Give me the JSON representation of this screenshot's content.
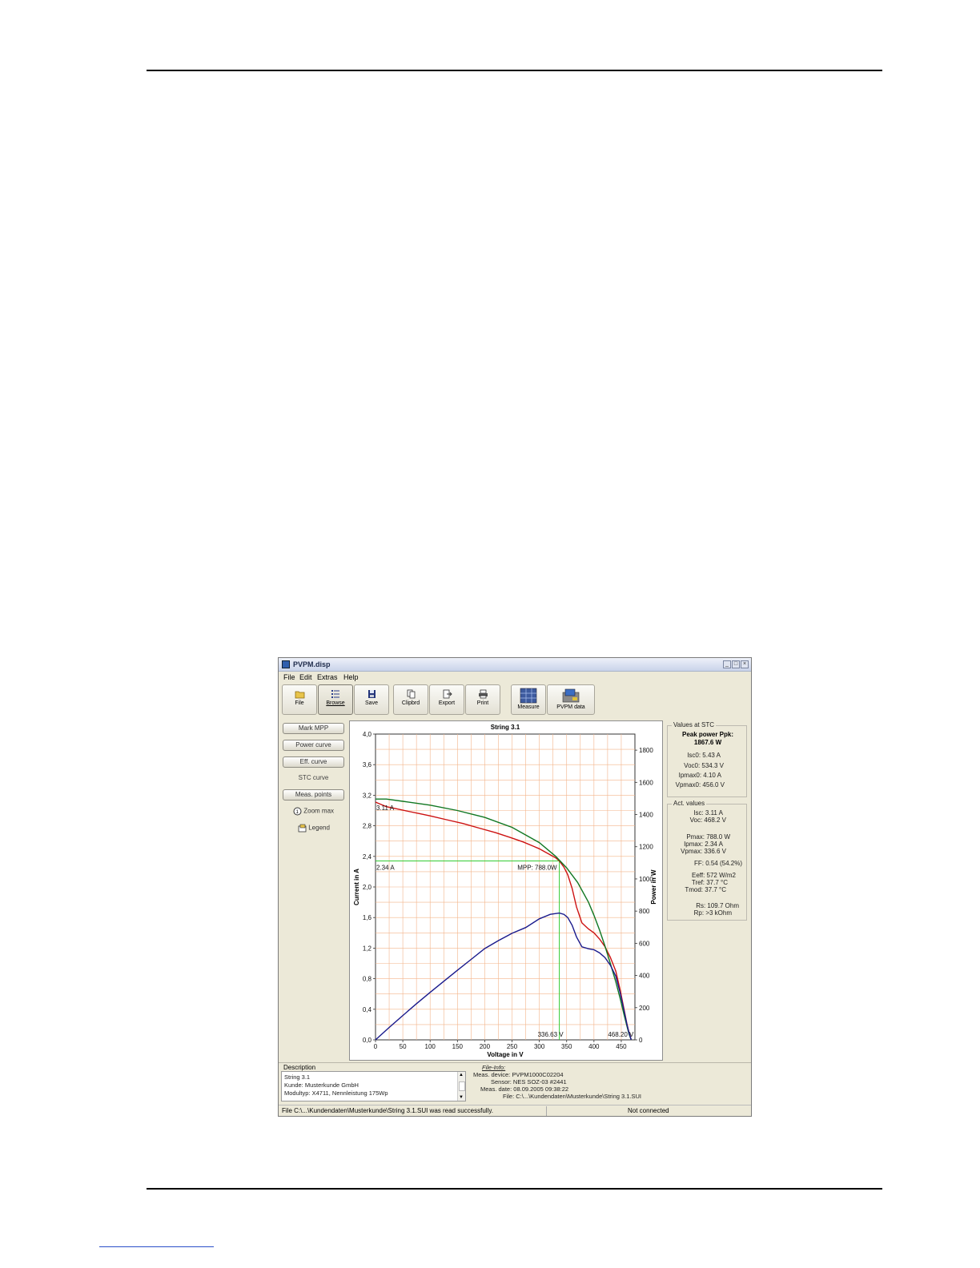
{
  "window": {
    "title": "PVPM.disp",
    "controls": [
      "_",
      "□",
      "×"
    ]
  },
  "menu": [
    "File",
    "Edit",
    "Extras",
    "Help"
  ],
  "toolbar": [
    {
      "label": "File",
      "icon": "folder-icon"
    },
    {
      "label": "Browse",
      "icon": "browse-icon",
      "active": true
    },
    {
      "label": "Save",
      "icon": "floppy-icon"
    },
    {
      "label": "Clipbrd",
      "icon": "clipboard-icon"
    },
    {
      "label": "Export",
      "icon": "export-icon"
    },
    {
      "label": "Print",
      "icon": "printer-icon"
    },
    {
      "label": "Measure",
      "icon": "measure-icon"
    },
    {
      "label": "PVPM data",
      "icon": "device-icon"
    }
  ],
  "left_panel": {
    "mark_mpp": "Mark MPP",
    "power_curve": "Power curve",
    "eff_curve": "Eff. curve",
    "stc_curve": "STC curve",
    "meas_points": "Meas. points",
    "zoom_max": "Zoom max",
    "legend": "Legend"
  },
  "values_stc": {
    "title": "Values at STC",
    "peak_label": "Peak power Ppk:",
    "peak_value": "1867.6 W",
    "isc0": "Isc0: 5.43 A",
    "voc0": "Voc0: 534.3 V",
    "ipmax0": "Ipmax0: 4.10 A",
    "vpmax0": "Vpmax0: 456.0 V"
  },
  "act_values": {
    "title": "Act. values",
    "isc": "Isc: 3.11 A",
    "voc": "Voc: 468.2 V",
    "pmax": "Pmax: 788.0 W",
    "ipmax": "Ipmax: 2.34 A",
    "vpmax": "Vpmax: 336.6 V",
    "ff": "FF: 0.54 (54.2%)",
    "eeff": "Eeff: 572 W/m2",
    "tref": "Tref: 37.7 °C",
    "tmod": "Tmod: 37.7 °C",
    "rs": "Rs: 109.7 Ohm",
    "rp": "Rp: >3 kOhm"
  },
  "description": {
    "label": "Description",
    "lines": [
      "String 3.1",
      "Kunde: Musterkunde GmbH",
      "Modultyp: X4711, Nennleistung 175Wp"
    ]
  },
  "file_info": {
    "title": "File-Info:",
    "meas_device": "Meas. device: PVPM1000C02204",
    "sensor": "Sensor: NES SOZ-03 #2441",
    "meas_date": "Meas. date: 08.09.2005 09:38:22",
    "file": "File: C:\\...\\Kundendaten\\Musterkunde\\String 3.1.SUI"
  },
  "status": {
    "left": "File C:\\...\\Kundendaten\\Musterkunde\\String 3.1.SUI was read successfully.",
    "right": "Not connected"
  },
  "chart_data": {
    "type": "line",
    "title": "String 3.1",
    "xlabel": "Voltage in V",
    "ylabel": "Current in A",
    "y2label": "Power in W",
    "xlim": [
      0,
      475
    ],
    "ylim": [
      0,
      4.0
    ],
    "y2lim": [
      0,
      1900
    ],
    "xticks": [
      0,
      50,
      100,
      150,
      200,
      250,
      300,
      350,
      400,
      450
    ],
    "yticks": [
      "0,0",
      "0,4",
      "0,8",
      "1,2",
      "1,6",
      "2,0",
      "2,4",
      "2,8",
      "3,2",
      "3,6",
      "4,0"
    ],
    "y2ticks": [
      0,
      200,
      400,
      600,
      800,
      1000,
      1200,
      1400,
      1600,
      1800
    ],
    "grid": true,
    "annotations": {
      "isc_label": "3.11 A",
      "ipmax_label": "2.34 A",
      "mpp_label": "MPP: 788.0W",
      "vpmax_label": "336.63 V",
      "voc_label": "468.20 V"
    },
    "mpp": {
      "v": 336.6,
      "i": 2.34
    },
    "series": [
      {
        "color": "#cc1111",
        "axis": "current",
        "x": [
          0,
          10,
          20,
          40,
          60,
          80,
          100,
          130,
          160,
          190,
          220,
          250,
          270,
          290,
          300,
          310,
          320,
          330,
          336.6,
          345,
          352,
          360,
          368,
          378,
          390,
          400,
          410,
          420,
          430,
          440,
          448,
          455,
          460,
          464,
          468.2
        ],
        "y": [
          3.11,
          3.08,
          3.05,
          3.02,
          2.99,
          2.96,
          2.93,
          2.88,
          2.83,
          2.77,
          2.71,
          2.64,
          2.59,
          2.53,
          2.5,
          2.46,
          2.42,
          2.38,
          2.34,
          2.26,
          2.16,
          1.98,
          1.74,
          1.53,
          1.45,
          1.4,
          1.32,
          1.22,
          1.08,
          0.9,
          0.65,
          0.4,
          0.22,
          0.1,
          0.0
        ]
      },
      {
        "color": "#117722",
        "axis": "current",
        "x": [
          0,
          20,
          50,
          100,
          150,
          200,
          250,
          300,
          330,
          350,
          370,
          390,
          400,
          410,
          420,
          430,
          440,
          448,
          455,
          460,
          464,
          468.2
        ],
        "y": [
          3.15,
          3.15,
          3.12,
          3.07,
          3.0,
          2.91,
          2.78,
          2.58,
          2.4,
          2.25,
          2.06,
          1.8,
          1.63,
          1.44,
          1.23,
          1.0,
          0.76,
          0.54,
          0.33,
          0.19,
          0.08,
          0.0
        ]
      },
      {
        "color": "#1a1a8c",
        "axis": "power",
        "x": [
          0,
          25,
          50,
          75,
          100,
          125,
          150,
          175,
          200,
          225,
          250,
          275,
          300,
          320,
          336.6,
          345,
          352,
          360,
          368,
          378,
          390,
          400,
          410,
          420,
          430,
          440,
          448,
          455,
          460,
          464,
          468.2
        ],
        "y": [
          0,
          77,
          151,
          225,
          295,
          364,
          432,
          500,
          567,
          617,
          662,
          698,
          752,
          780,
          788,
          780,
          760,
          712,
          640,
          578,
          566,
          560,
          541,
          512,
          464,
          396,
          291,
          182,
          101,
          46,
          0
        ]
      }
    ]
  }
}
